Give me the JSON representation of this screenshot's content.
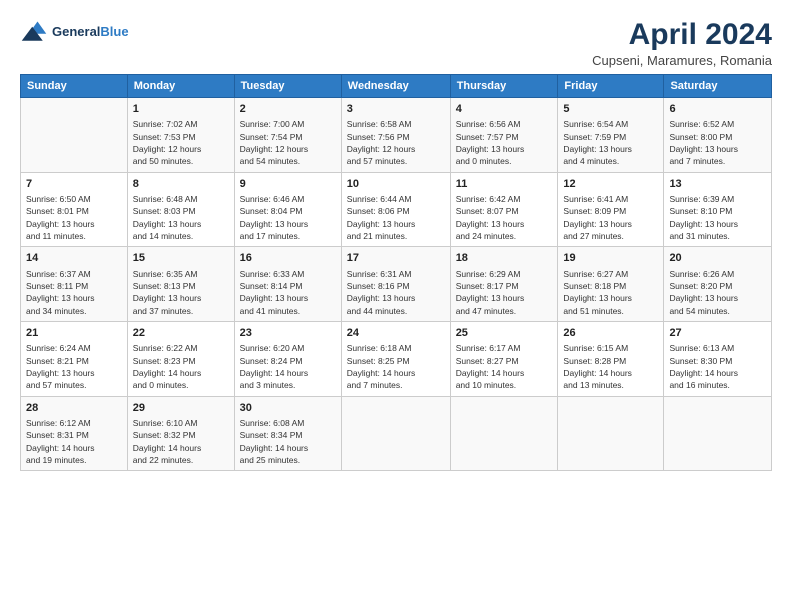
{
  "logo": {
    "line1": "General",
    "line2": "Blue"
  },
  "title": "April 2024",
  "subtitle": "Cupseni, Maramures, Romania",
  "days_of_week": [
    "Sunday",
    "Monday",
    "Tuesday",
    "Wednesday",
    "Thursday",
    "Friday",
    "Saturday"
  ],
  "weeks": [
    [
      {
        "day": "",
        "sunrise": "",
        "sunset": "",
        "daylight": ""
      },
      {
        "day": "1",
        "sunrise": "Sunrise: 7:02 AM",
        "sunset": "Sunset: 7:53 PM",
        "daylight": "Daylight: 12 hours and 50 minutes."
      },
      {
        "day": "2",
        "sunrise": "Sunrise: 7:00 AM",
        "sunset": "Sunset: 7:54 PM",
        "daylight": "Daylight: 12 hours and 54 minutes."
      },
      {
        "day": "3",
        "sunrise": "Sunrise: 6:58 AM",
        "sunset": "Sunset: 7:56 PM",
        "daylight": "Daylight: 12 hours and 57 minutes."
      },
      {
        "day": "4",
        "sunrise": "Sunrise: 6:56 AM",
        "sunset": "Sunset: 7:57 PM",
        "daylight": "Daylight: 13 hours and 0 minutes."
      },
      {
        "day": "5",
        "sunrise": "Sunrise: 6:54 AM",
        "sunset": "Sunset: 7:59 PM",
        "daylight": "Daylight: 13 hours and 4 minutes."
      },
      {
        "day": "6",
        "sunrise": "Sunrise: 6:52 AM",
        "sunset": "Sunset: 8:00 PM",
        "daylight": "Daylight: 13 hours and 7 minutes."
      }
    ],
    [
      {
        "day": "7",
        "sunrise": "Sunrise: 6:50 AM",
        "sunset": "Sunset: 8:01 PM",
        "daylight": "Daylight: 13 hours and 11 minutes."
      },
      {
        "day": "8",
        "sunrise": "Sunrise: 6:48 AM",
        "sunset": "Sunset: 8:03 PM",
        "daylight": "Daylight: 13 hours and 14 minutes."
      },
      {
        "day": "9",
        "sunrise": "Sunrise: 6:46 AM",
        "sunset": "Sunset: 8:04 PM",
        "daylight": "Daylight: 13 hours and 17 minutes."
      },
      {
        "day": "10",
        "sunrise": "Sunrise: 6:44 AM",
        "sunset": "Sunset: 8:06 PM",
        "daylight": "Daylight: 13 hours and 21 minutes."
      },
      {
        "day": "11",
        "sunrise": "Sunrise: 6:42 AM",
        "sunset": "Sunset: 8:07 PM",
        "daylight": "Daylight: 13 hours and 24 minutes."
      },
      {
        "day": "12",
        "sunrise": "Sunrise: 6:41 AM",
        "sunset": "Sunset: 8:09 PM",
        "daylight": "Daylight: 13 hours and 27 minutes."
      },
      {
        "day": "13",
        "sunrise": "Sunrise: 6:39 AM",
        "sunset": "Sunset: 8:10 PM",
        "daylight": "Daylight: 13 hours and 31 minutes."
      }
    ],
    [
      {
        "day": "14",
        "sunrise": "Sunrise: 6:37 AM",
        "sunset": "Sunset: 8:11 PM",
        "daylight": "Daylight: 13 hours and 34 minutes."
      },
      {
        "day": "15",
        "sunrise": "Sunrise: 6:35 AM",
        "sunset": "Sunset: 8:13 PM",
        "daylight": "Daylight: 13 hours and 37 minutes."
      },
      {
        "day": "16",
        "sunrise": "Sunrise: 6:33 AM",
        "sunset": "Sunset: 8:14 PM",
        "daylight": "Daylight: 13 hours and 41 minutes."
      },
      {
        "day": "17",
        "sunrise": "Sunrise: 6:31 AM",
        "sunset": "Sunset: 8:16 PM",
        "daylight": "Daylight: 13 hours and 44 minutes."
      },
      {
        "day": "18",
        "sunrise": "Sunrise: 6:29 AM",
        "sunset": "Sunset: 8:17 PM",
        "daylight": "Daylight: 13 hours and 47 minutes."
      },
      {
        "day": "19",
        "sunrise": "Sunrise: 6:27 AM",
        "sunset": "Sunset: 8:18 PM",
        "daylight": "Daylight: 13 hours and 51 minutes."
      },
      {
        "day": "20",
        "sunrise": "Sunrise: 6:26 AM",
        "sunset": "Sunset: 8:20 PM",
        "daylight": "Daylight: 13 hours and 54 minutes."
      }
    ],
    [
      {
        "day": "21",
        "sunrise": "Sunrise: 6:24 AM",
        "sunset": "Sunset: 8:21 PM",
        "daylight": "Daylight: 13 hours and 57 minutes."
      },
      {
        "day": "22",
        "sunrise": "Sunrise: 6:22 AM",
        "sunset": "Sunset: 8:23 PM",
        "daylight": "Daylight: 14 hours and 0 minutes."
      },
      {
        "day": "23",
        "sunrise": "Sunrise: 6:20 AM",
        "sunset": "Sunset: 8:24 PM",
        "daylight": "Daylight: 14 hours and 3 minutes."
      },
      {
        "day": "24",
        "sunrise": "Sunrise: 6:18 AM",
        "sunset": "Sunset: 8:25 PM",
        "daylight": "Daylight: 14 hours and 7 minutes."
      },
      {
        "day": "25",
        "sunrise": "Sunrise: 6:17 AM",
        "sunset": "Sunset: 8:27 PM",
        "daylight": "Daylight: 14 hours and 10 minutes."
      },
      {
        "day": "26",
        "sunrise": "Sunrise: 6:15 AM",
        "sunset": "Sunset: 8:28 PM",
        "daylight": "Daylight: 14 hours and 13 minutes."
      },
      {
        "day": "27",
        "sunrise": "Sunrise: 6:13 AM",
        "sunset": "Sunset: 8:30 PM",
        "daylight": "Daylight: 14 hours and 16 minutes."
      }
    ],
    [
      {
        "day": "28",
        "sunrise": "Sunrise: 6:12 AM",
        "sunset": "Sunset: 8:31 PM",
        "daylight": "Daylight: 14 hours and 19 minutes."
      },
      {
        "day": "29",
        "sunrise": "Sunrise: 6:10 AM",
        "sunset": "Sunset: 8:32 PM",
        "daylight": "Daylight: 14 hours and 22 minutes."
      },
      {
        "day": "30",
        "sunrise": "Sunrise: 6:08 AM",
        "sunset": "Sunset: 8:34 PM",
        "daylight": "Daylight: 14 hours and 25 minutes."
      },
      {
        "day": "",
        "sunrise": "",
        "sunset": "",
        "daylight": ""
      },
      {
        "day": "",
        "sunrise": "",
        "sunset": "",
        "daylight": ""
      },
      {
        "day": "",
        "sunrise": "",
        "sunset": "",
        "daylight": ""
      },
      {
        "day": "",
        "sunrise": "",
        "sunset": "",
        "daylight": ""
      }
    ]
  ]
}
